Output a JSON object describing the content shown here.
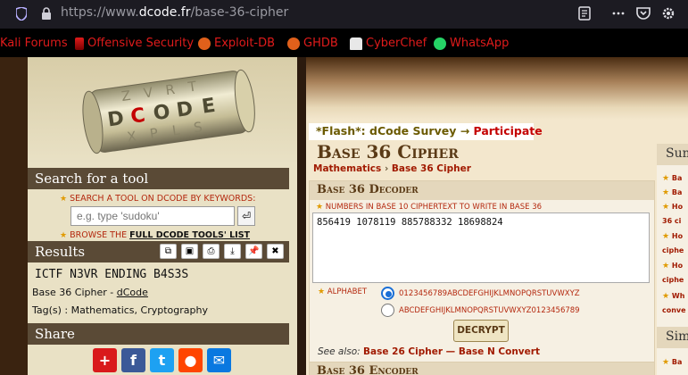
{
  "browser": {
    "url_prefix": "https://www.",
    "url_domain": "dcode.fr",
    "url_path": "/base-36-cipher",
    "bookmarks": [
      {
        "label": "Kali Forums",
        "icon": "kali-icon"
      },
      {
        "label": "Offensive Security",
        "icon": "offsec-icon"
      },
      {
        "label": "Exploit-DB",
        "icon": "exploitdb-icon"
      },
      {
        "label": "GHDB",
        "icon": "ghdb-icon"
      },
      {
        "label": "CyberChef",
        "icon": "cyberchef-icon"
      },
      {
        "label": "WhatsApp",
        "icon": "whatsapp-icon"
      }
    ]
  },
  "logo": {
    "text": "DCODE"
  },
  "sidebar": {
    "search_title": "Search for a tool",
    "search_hint": "SEARCH A TOOL ON DCODE BY KEYWORDS:",
    "search_placeholder": "e.g. type 'sudoku'",
    "browse_prefix": "BROWSE THE ",
    "browse_link": "FULL DCODE TOOLS' LIST",
    "results_title": "Results",
    "result_value": "ICTF N3VR ENDING B4S3S",
    "result_source_prefix": "Base 36 Cipher - ",
    "result_source_link": "dCode",
    "tags": "Tag(s) : Mathematics, Cryptography",
    "share_title": "Share"
  },
  "main": {
    "flash_prefix": "*Flash*: dCode Survey → ",
    "flash_link": "Participate",
    "title": "Base 36 Cipher",
    "crumb_1": "Mathematics",
    "crumb_sep": "›",
    "crumb_2": "Base 36 Cipher",
    "decoder_title": "Base 36 Decoder",
    "numbers_label": "NUMBERS IN BASE 10 CIPHERTEXT TO WRITE IN BASE 36",
    "numbers_value": "856419 1078119 885788332 18698824",
    "alphabet_label": "ALPHABET",
    "alphabet_1": "0123456789ABCDEFGHIJKLMNOPQRSTUVWXYZ",
    "alphabet_2": "ABCDEFGHIJKLMNOPQRSTUVWXYZ0123456789",
    "decrypt_label": "DECRYPT",
    "see_also": "See also: ",
    "see_also_1": "Base 26 Cipher",
    "see_also_sep": " — ",
    "see_also_2": "Base N Convert",
    "encoder_title": "Base 36 Encoder"
  },
  "right": {
    "head_1": "Sum",
    "lines": [
      "Ba",
      "Ba",
      "Ho",
      "36 ci",
      "Ho",
      "ciphe",
      "Ho",
      "ciphe",
      "Wh",
      "conve"
    ],
    "head_2": "Sim",
    "line_last": "Ba"
  },
  "colors": {
    "accent": "#a11a00",
    "whatsapp": "#25d366"
  }
}
